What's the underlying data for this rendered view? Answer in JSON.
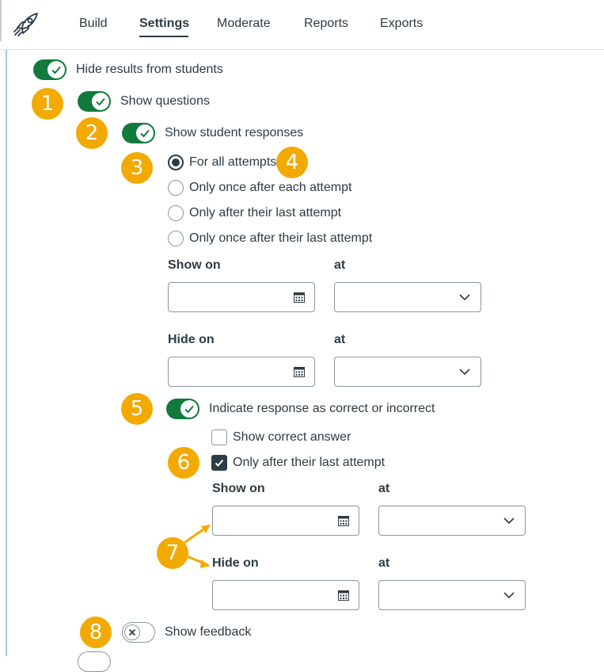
{
  "nav": {
    "tabs": [
      {
        "label": "Build"
      },
      {
        "label": "Settings"
      },
      {
        "label": "Moderate"
      },
      {
        "label": "Reports"
      },
      {
        "label": "Exports"
      }
    ],
    "active_tab": "Settings"
  },
  "settings": {
    "hide_results": {
      "label": "Hide results from students",
      "on": true
    },
    "show_questions": {
      "label": "Show questions",
      "on": true
    },
    "show_student_responses": {
      "label": "Show student responses",
      "on": true
    },
    "attempt_options": [
      {
        "label": "For all attempts",
        "checked": true
      },
      {
        "label": "Only once after each attempt",
        "checked": false
      },
      {
        "label": "Only after their last attempt",
        "checked": false
      },
      {
        "label": "Only once after their last attempt",
        "checked": false
      }
    ],
    "responses_show_on_label": "Show on",
    "responses_show_at_label": "at",
    "responses_hide_on_label": "Hide on",
    "responses_hide_at_label": "at",
    "indicate_correct": {
      "label": "Indicate response as correct or incorrect",
      "on": true
    },
    "show_correct_answer": {
      "label": "Show correct answer",
      "checked": false
    },
    "only_after_last": {
      "label": "Only after their last attempt",
      "checked": true
    },
    "correct_show_on_label": "Show on",
    "correct_show_at_label": "at",
    "correct_hide_on_label": "Hide on",
    "correct_hide_at_label": "at",
    "show_feedback": {
      "label": "Show feedback",
      "on": false
    }
  },
  "callouts": [
    "1",
    "2",
    "3",
    "4",
    "5",
    "6",
    "7",
    "8"
  ],
  "colors": {
    "toggle_on": "#127a3c",
    "badge": "#f2a900",
    "text": "#2d3b45",
    "border": "#8b969e"
  },
  "icons": {
    "logo": "rocket-icon",
    "date": "calendar-icon",
    "select": "chevron-down-icon",
    "toggle_on": "checkmark-icon",
    "toggle_off": "x-icon"
  }
}
